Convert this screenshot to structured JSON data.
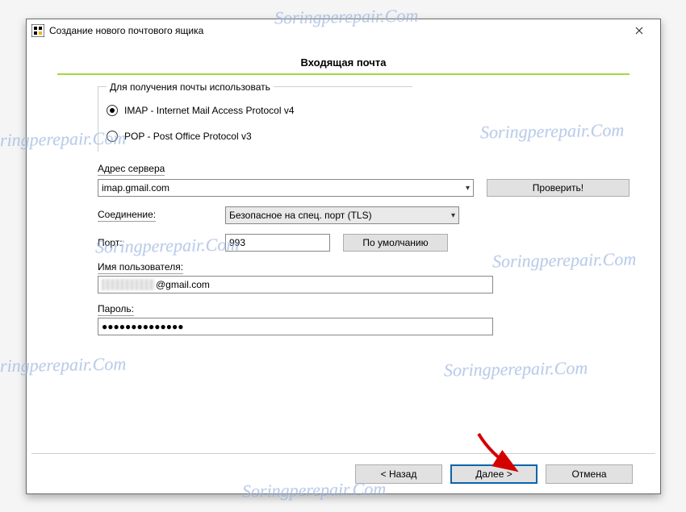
{
  "window": {
    "title": "Создание нового почтового ящика"
  },
  "heading": "Входящая почта",
  "protocol_group": {
    "legend": "Для получения почты использовать",
    "option_imap": "IMAP - Internet Mail Access Protocol v4",
    "option_pop": "POP  -  Post Office Protocol v3",
    "selected": "imap"
  },
  "server": {
    "label": "Адрес сервера",
    "value": "imap.gmail.com",
    "check_button": "Проверить!"
  },
  "connection": {
    "label": "Соединение:",
    "value": "Безопасное на спец. порт (TLS)"
  },
  "port": {
    "label": "Порт:",
    "value": "993",
    "default_button": "По умолчанию"
  },
  "username": {
    "label": "Имя пользователя:",
    "suffix": "@gmail.com"
  },
  "password": {
    "label": "Пароль:",
    "value": "●●●●●●●●●●●●●●"
  },
  "buttons": {
    "back": "<  Назад",
    "next": "Далее  >",
    "cancel": "Отмена"
  },
  "watermark": "Soringperepair.Com"
}
